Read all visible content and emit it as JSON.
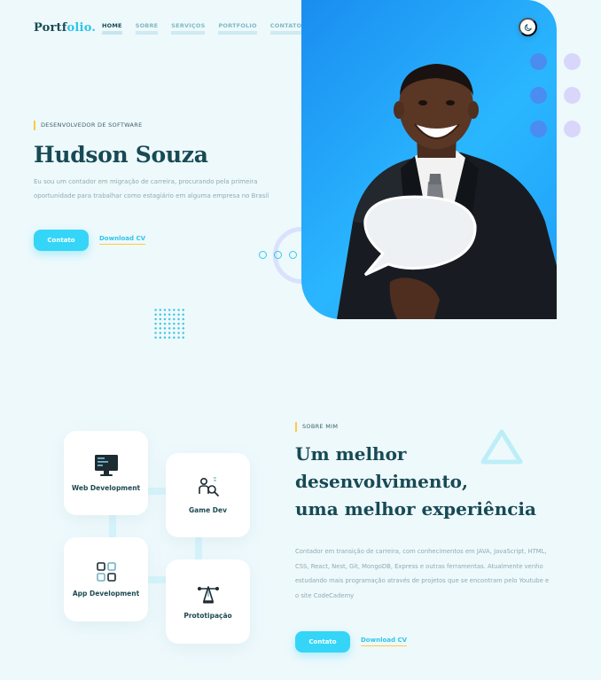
{
  "brand": {
    "part1": "Portf",
    "part2": "olio."
  },
  "nav": [
    {
      "label": "HOME"
    },
    {
      "label": "SOBRE"
    },
    {
      "label": "SERVIÇOS"
    },
    {
      "label": "PORTFOLIO"
    },
    {
      "label": "CONTATO"
    }
  ],
  "hero": {
    "tag": "DESENVOLVEDOR DE SOFTWARE",
    "name": "Hudson Souza",
    "description": "Eu sou um contador em migração de carreira, procurando pela primeira oportunidade para trabalhar como estagiário em alguma empresa no Brasil",
    "contact_button": "Contato",
    "cv_link": "Download CV",
    "photo_alt": "Hudson Souza segurando balão de fala",
    "slider_dots": 6
  },
  "about": {
    "tag": "SOBRE MIM",
    "title_line1": "Um melhor",
    "title_line2": "desenvolvimento,",
    "title_line3": "uma melhor experiência",
    "description": "Contador em transição de carreira, com conhecimentos em JAVA, JavaScript, HTML, CSS, React, Nest, Git, MongoDB, Express e outras ferramentas. Atualmente venho estudando mais programação através de projetos que se encontram pelo Youtube e o site CodeCademy",
    "contact_button": "Contato",
    "cv_link": "Download CV"
  },
  "services": [
    {
      "label": "Web Development",
      "icon": "monitor-icon"
    },
    {
      "label": "Game Dev",
      "icon": "user-search-icon"
    },
    {
      "label": "App Development",
      "icon": "grid-apps-icon"
    },
    {
      "label": "Prototipação",
      "icon": "pen-tool-icon"
    }
  ],
  "colors": {
    "accent": "#35d5f7",
    "brand_dark": "#174a55",
    "highlight": "#ffc845",
    "background": "#eef9fc"
  }
}
